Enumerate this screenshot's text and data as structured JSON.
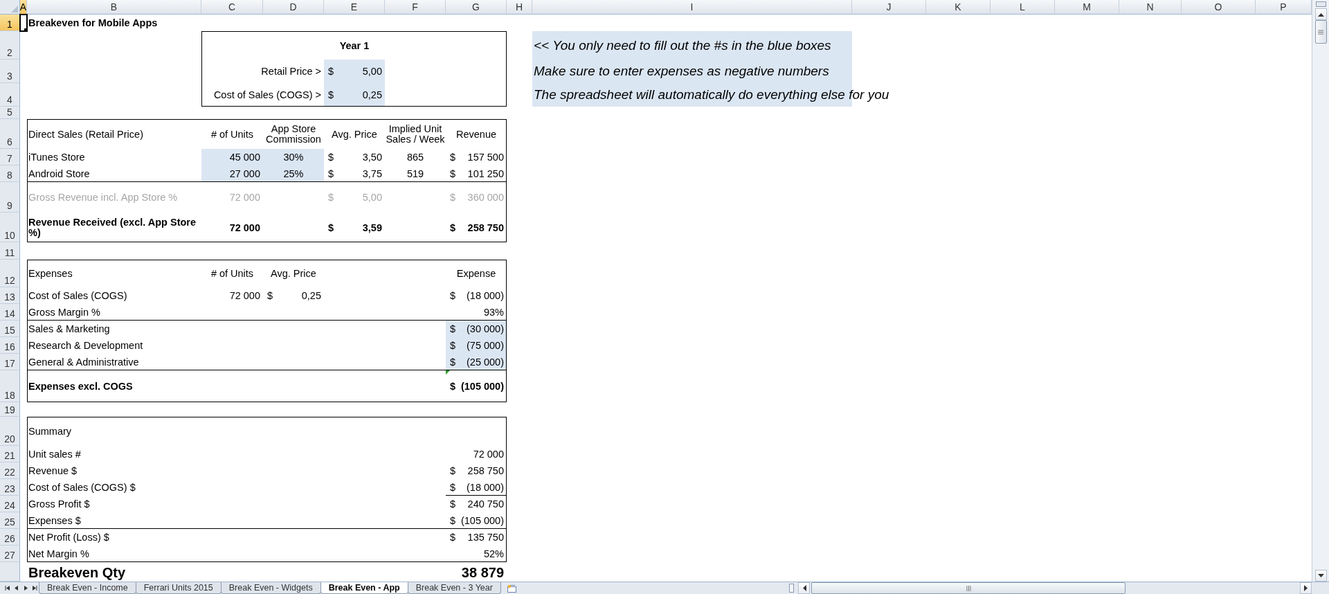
{
  "column_headers": [
    {
      "label": "A",
      "selected": true
    },
    {
      "label": "B",
      "selected": false
    },
    {
      "label": "C",
      "selected": false
    },
    {
      "label": "D",
      "selected": false
    },
    {
      "label": "E",
      "selected": false
    },
    {
      "label": "F",
      "selected": false
    },
    {
      "label": "G",
      "selected": false
    },
    {
      "label": "H",
      "selected": false
    },
    {
      "label": "I",
      "selected": false
    },
    {
      "label": "J",
      "selected": false
    },
    {
      "label": "K",
      "selected": false
    },
    {
      "label": "L",
      "selected": false
    },
    {
      "label": "M",
      "selected": false
    },
    {
      "label": "N",
      "selected": false
    },
    {
      "label": "O",
      "selected": false
    },
    {
      "label": "P",
      "selected": false
    }
  ],
  "rows": [
    {
      "header": "1",
      "selected": true,
      "cells": {
        "A": {
          "cursor": true
        },
        "B": {
          "kind": "label",
          "text": "Breakeven for Mobile Apps",
          "bold": true
        }
      }
    },
    {
      "header": "2",
      "selected": false,
      "cells": {
        "E": {
          "kind": "heading",
          "text": "Year 1",
          "bold": true
        },
        "I": {
          "kind": "label",
          "text": "<< You only need to fill out the #s in the blue boxes",
          "italic": true,
          "input": true
        }
      }
    },
    {
      "header": "3",
      "selected": false,
      "cells": {
        "D": {
          "kind": "number",
          "text": "Retail Price >"
        },
        "E": {
          "kind": "amount",
          "currency": "$",
          "text": "5,00",
          "input": true
        },
        "I": {
          "kind": "label",
          "text": "Make sure to enter expenses as negative numbers",
          "italic": true,
          "input": true
        }
      }
    },
    {
      "header": "4",
      "selected": false,
      "cells": {
        "D": {
          "kind": "number",
          "text": "Cost of Sales (COGS) >"
        },
        "E": {
          "kind": "amount",
          "currency": "$",
          "text": "0,25",
          "input": true
        },
        "I": {
          "kind": "label",
          "text": "The spreadsheet will automatically do everything else for you",
          "italic": true,
          "input": true
        }
      }
    },
    {
      "header": "5",
      "selected": false,
      "cells": {}
    },
    {
      "header": "6",
      "selected": false,
      "cells": {
        "B": {
          "kind": "label",
          "text": "Direct Sales (Retail Price)"
        },
        "C": {
          "kind": "heading",
          "text": "# of Units"
        },
        "D": {
          "kind": "heading",
          "text": "App Store Commission",
          "wrap": true
        },
        "E": {
          "kind": "heading",
          "text": "Avg. Price"
        },
        "F": {
          "kind": "heading",
          "text": "Implied Unit Sales / Week",
          "wrap": true
        },
        "G": {
          "kind": "heading",
          "text": "Revenue"
        }
      }
    },
    {
      "header": "7",
      "selected": false,
      "cells": {
        "B": {
          "kind": "label",
          "text": "iTunes Store"
        },
        "C": {
          "kind": "number",
          "text": "45 000",
          "input": true
        },
        "D": {
          "kind": "heading",
          "text": "30%",
          "input": true
        },
        "E": {
          "kind": "amount",
          "currency": "$",
          "text": "3,50"
        },
        "F": {
          "kind": "heading",
          "text": "865"
        },
        "G": {
          "kind": "amount",
          "currency": "$",
          "text": "157 500"
        }
      }
    },
    {
      "header": "8",
      "selected": false,
      "cells": {
        "B": {
          "kind": "label",
          "text": "Android Store"
        },
        "C": {
          "kind": "number",
          "text": "27 000",
          "input": true
        },
        "D": {
          "kind": "heading",
          "text": "25%",
          "input": true
        },
        "E": {
          "kind": "amount",
          "currency": "$",
          "text": "3,75"
        },
        "F": {
          "kind": "heading",
          "text": "519"
        },
        "G": {
          "kind": "amount",
          "currency": "$",
          "text": "101 250"
        }
      }
    },
    {
      "header": "9",
      "selected": false,
      "cells": {
        "B": {
          "kind": "label",
          "text": "Gross Revenue incl. App Store %",
          "muted": true
        },
        "C": {
          "kind": "number",
          "text": "72 000",
          "muted": true
        },
        "E": {
          "kind": "amount",
          "currency": "$",
          "text": "5,00",
          "muted": true
        },
        "G": {
          "kind": "amount",
          "currency": "$",
          "text": "360 000",
          "muted": true
        }
      }
    },
    {
      "header": "10",
      "selected": false,
      "cells": {
        "B": {
          "kind": "label",
          "text": "Revenue Received (excl. App Store %)",
          "bold": true,
          "wrap": true
        },
        "C": {
          "kind": "number",
          "text": "72 000",
          "bold": true
        },
        "E": {
          "kind": "amount",
          "currency": "$",
          "text": "3,59",
          "bold": true
        },
        "G": {
          "kind": "amount",
          "currency": "$",
          "text": "258 750",
          "bold": true
        }
      }
    },
    {
      "header": "11",
      "selected": false,
      "cells": {}
    },
    {
      "header": "12",
      "selected": false,
      "cells": {
        "B": {
          "kind": "label",
          "text": "Expenses"
        },
        "C": {
          "kind": "heading",
          "text": "# of Units"
        },
        "D": {
          "kind": "heading",
          "text": "Avg. Price"
        },
        "G": {
          "kind": "heading",
          "text": "Expense"
        }
      }
    },
    {
      "header": "13",
      "selected": false,
      "cells": {
        "B": {
          "kind": "label",
          "text": "Cost of Sales (COGS)"
        },
        "C": {
          "kind": "number",
          "text": "72 000"
        },
        "D": {
          "kind": "amount",
          "currency": "$",
          "text": "0,25"
        },
        "G": {
          "kind": "amount",
          "currency": "$",
          "text": "(18 000)"
        }
      }
    },
    {
      "header": "14",
      "selected": false,
      "cells": {
        "B": {
          "kind": "label",
          "text": "Gross Margin %"
        },
        "G": {
          "kind": "number",
          "text": "93%"
        }
      }
    },
    {
      "header": "15",
      "selected": false,
      "cells": {
        "B": {
          "kind": "label",
          "text": "Sales & Marketing"
        },
        "G": {
          "kind": "amount",
          "currency": "$",
          "text": "(30 000)",
          "input": true
        }
      }
    },
    {
      "header": "16",
      "selected": false,
      "cells": {
        "B": {
          "kind": "label",
          "text": "Research & Development"
        },
        "G": {
          "kind": "amount",
          "currency": "$",
          "text": "(75 000)",
          "input": true
        }
      }
    },
    {
      "header": "17",
      "selected": false,
      "cells": {
        "B": {
          "kind": "label",
          "text": "General & Administrative"
        },
        "G": {
          "kind": "amount",
          "currency": "$",
          "text": "(25 000)",
          "input": true
        }
      }
    },
    {
      "header": "18",
      "selected": false,
      "cells": {
        "B": {
          "kind": "label",
          "text": "Expenses excl. COGS",
          "bold": true
        },
        "G": {
          "kind": "amount",
          "currency": "$",
          "text": "(105 000)",
          "bold": true,
          "flagged": true
        }
      }
    },
    {
      "header": "19",
      "selected": false,
      "cells": {}
    },
    {
      "header": "20",
      "selected": false,
      "cells": {
        "B": {
          "kind": "label",
          "text": "Summary"
        }
      }
    },
    {
      "header": "21",
      "selected": false,
      "cells": {
        "B": {
          "kind": "label",
          "text": "Unit sales #"
        },
        "G": {
          "kind": "number",
          "text": "72 000"
        }
      }
    },
    {
      "header": "22",
      "selected": false,
      "cells": {
        "B": {
          "kind": "label",
          "text": "Revenue $"
        },
        "G": {
          "kind": "amount",
          "currency": "$",
          "text": "258 750"
        }
      }
    },
    {
      "header": "23",
      "selected": false,
      "cells": {
        "B": {
          "kind": "label",
          "text": "Cost of Sales (COGS) $"
        },
        "G": {
          "kind": "amount",
          "currency": "$",
          "text": "(18 000)"
        }
      }
    },
    {
      "header": "24",
      "selected": false,
      "cells": {
        "B": {
          "kind": "label",
          "text": "Gross Profit $"
        },
        "G": {
          "kind": "amount",
          "currency": "$",
          "text": "240 750"
        }
      }
    },
    {
      "header": "25",
      "selected": false,
      "cells": {
        "B": {
          "kind": "label",
          "text": "Expenses $"
        },
        "G": {
          "kind": "amount",
          "currency": "$",
          "text": "(105 000)"
        }
      }
    },
    {
      "header": "26",
      "selected": false,
      "cells": {
        "B": {
          "kind": "label",
          "text": "Net Profit (Loss) $"
        },
        "G": {
          "kind": "amount",
          "currency": "$",
          "text": "135 750"
        }
      }
    },
    {
      "header": "27",
      "selected": false,
      "cells": {
        "B": {
          "kind": "label",
          "text": "Net Margin %"
        },
        "G": {
          "kind": "number",
          "text": "52%"
        }
      }
    },
    {
      "cells": {
        "B": {
          "kind": "label",
          "text": "Breakeven Qty",
          "bold": true,
          "large": true
        },
        "G": {
          "kind": "number",
          "text": "38 879",
          "bold": true,
          "large": true
        }
      }
    }
  ],
  "sheet_tabs": [
    {
      "label": "Break Even - Income",
      "selected": false
    },
    {
      "label": "Ferrari Units 2015",
      "selected": false
    },
    {
      "label": "Break Even - Widgets",
      "selected": false
    },
    {
      "label": "Break Even - App",
      "selected": true
    },
    {
      "label": "Break Even - 3 Year",
      "selected": false
    }
  ]
}
